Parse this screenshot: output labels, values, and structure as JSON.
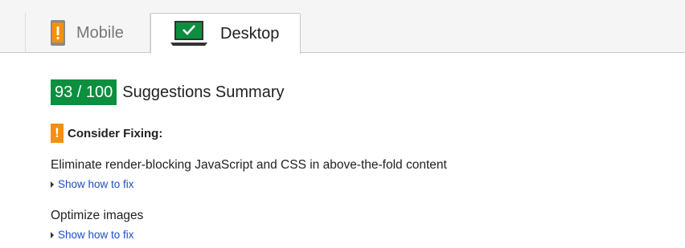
{
  "tabs": {
    "mobile": {
      "label": "Mobile",
      "icon": "mobile-phone-warning-icon",
      "icon_color": "#f4900c"
    },
    "desktop": {
      "label": "Desktop",
      "icon": "laptop-check-icon",
      "icon_color": "#0c8f3f",
      "selected": true
    }
  },
  "summary": {
    "score": "93 / 100",
    "score_color": "#0c8f3f",
    "title": "Suggestions Summary"
  },
  "consider": {
    "icon": "warning-exclamation-icon",
    "icon_glyph": "!",
    "icon_color": "#f4900c",
    "label": "Consider Fixing:"
  },
  "rules": [
    {
      "title": "Eliminate render-blocking JavaScript and CSS in above-the-fold content",
      "link": "Show how to fix"
    },
    {
      "title": "Optimize images",
      "link": "Show how to fix"
    }
  ],
  "colors": {
    "link": "#1a4ec8",
    "accent_green": "#0c8f3f",
    "accent_orange": "#f4900c"
  }
}
